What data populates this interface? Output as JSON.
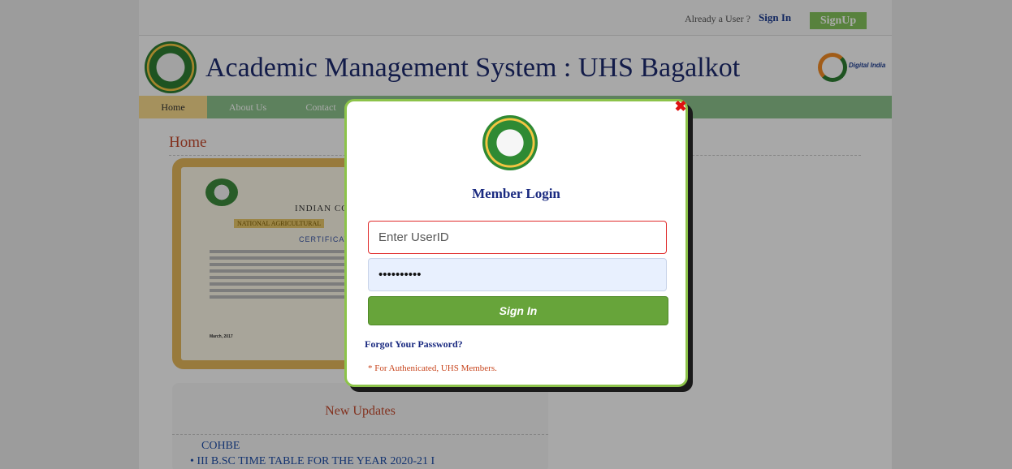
{
  "topbar": {
    "already_text": "Already a User ?",
    "signin_label": "Sign In",
    "signup_label": "SignUp"
  },
  "header": {
    "title": "Academic Management System : UHS Bagalkot",
    "digital_logo_text": "Digital India"
  },
  "nav": {
    "home": "Home",
    "about": "About Us",
    "contact": "Contact"
  },
  "main": {
    "heading": "Home",
    "certificate": {
      "line1": "INDIAN COUNCIL O",
      "line2": "NATIONAL AGRICULTURAL",
      "line3": "CERTIFICATE",
      "footer": "March, 2017"
    },
    "updates": {
      "title": "New Updates",
      "category": "COHBE",
      "items": [
        "III B.SC TIME TABLE FOR THE YEAR 2020-21 I"
      ]
    }
  },
  "login": {
    "title": "Member Login",
    "close_symbol": "✖",
    "userid_placeholder": "Enter UserID",
    "password_value": "••••••••••",
    "signin_label": "Sign In",
    "forgot_label": "Forgot Your Password?",
    "note": "* For Authenicated, UHS Members."
  }
}
